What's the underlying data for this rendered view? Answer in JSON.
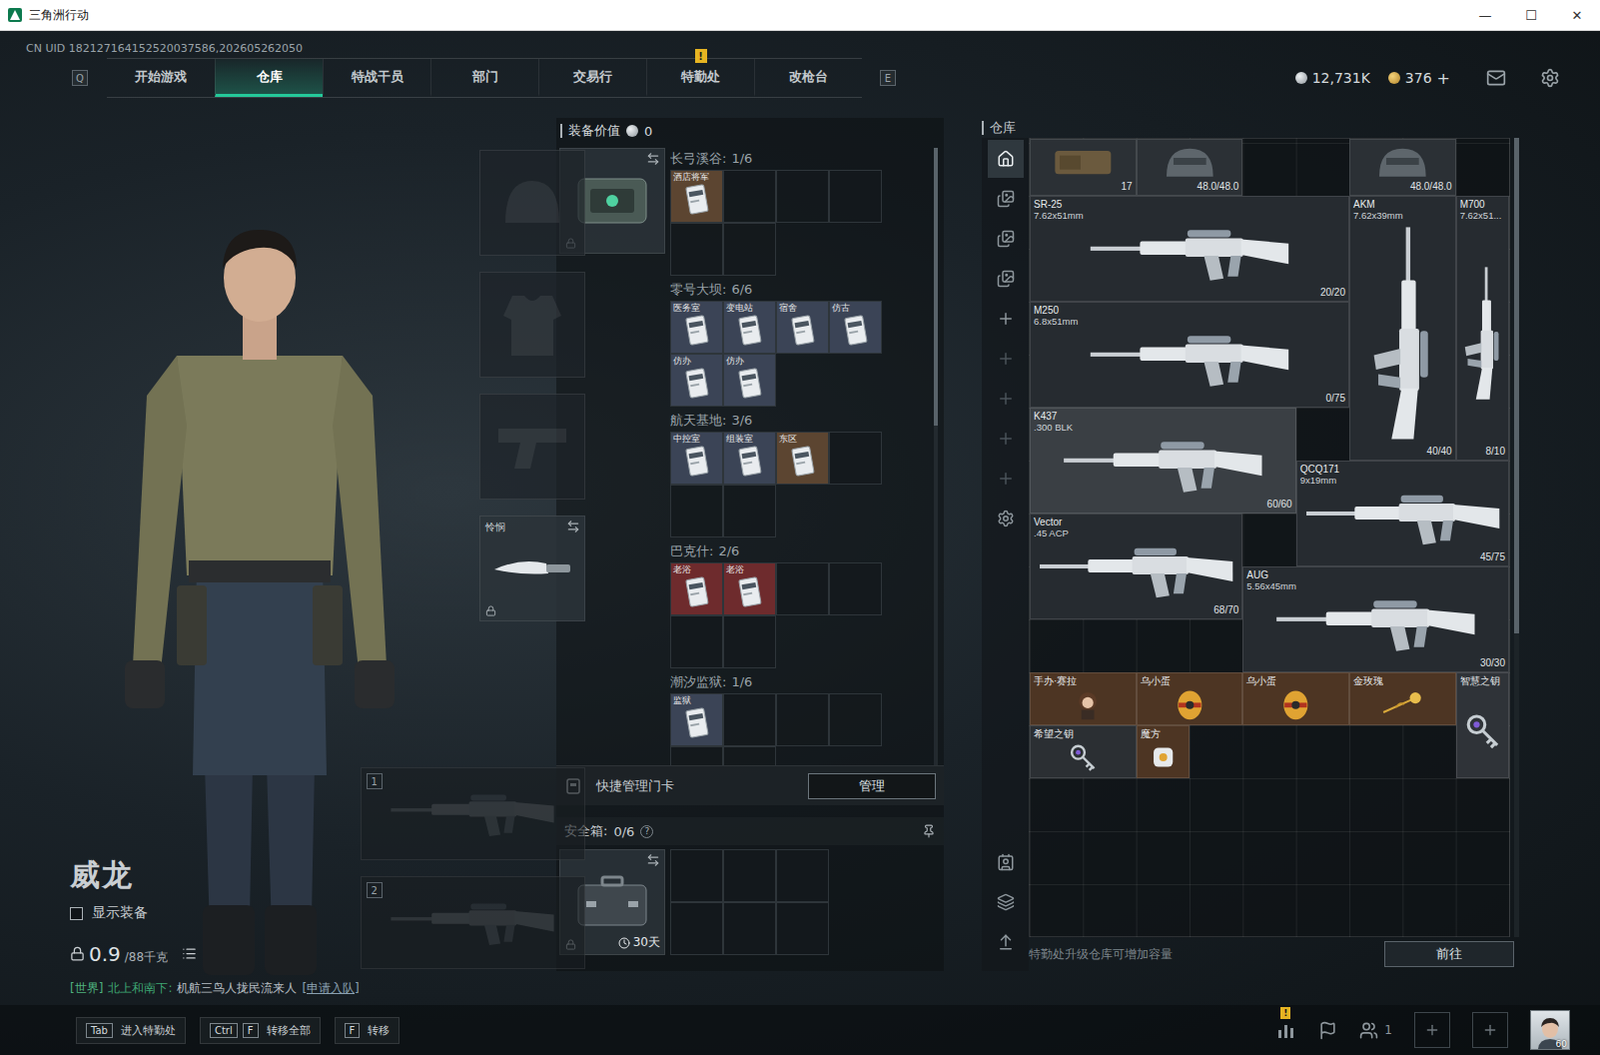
{
  "window": {
    "title": "三角洲行动",
    "controls": [
      "—",
      "☐",
      "✕"
    ]
  },
  "uid": "CN UID 182127164152520037586,202605262050",
  "nav": {
    "left_key": "Q",
    "right_key": "E",
    "tabs": [
      {
        "label": "开始游戏",
        "selected": false
      },
      {
        "label": "仓库",
        "selected": true
      },
      {
        "label": "特战干员",
        "selected": false
      },
      {
        "label": "部门",
        "selected": false
      },
      {
        "label": "交易行",
        "selected": false
      },
      {
        "label": "特勤处",
        "selected": false,
        "badge": "!"
      },
      {
        "label": "改枪台",
        "selected": false
      }
    ]
  },
  "currency": [
    {
      "kind": "silver",
      "amount": "12,731K"
    },
    {
      "kind": "gold",
      "amount": "376",
      "add": "+"
    }
  ],
  "character": {
    "name": "威龙",
    "show_equipment": {
      "label": "显示装备",
      "checked": false
    },
    "weight": "0.9",
    "capacity": "/88千克"
  },
  "equipment": [
    {
      "kind": "helmet",
      "filled": false,
      "locked": false
    },
    {
      "kind": "armor",
      "filled": false,
      "locked": false
    },
    {
      "kind": "pistol",
      "filled": false,
      "locked": false
    },
    {
      "kind": "melee",
      "label": "怜悯",
      "filled": true,
      "locked": true
    }
  ],
  "weapon_slots": [
    {
      "number": "1",
      "filled": false
    },
    {
      "number": "2",
      "filled": false
    }
  ],
  "chat": {
    "channel": "[世界]",
    "sender": "北上和南下:",
    "message": "机航三鸟人拢民流来人",
    "action": "[申请入队]"
  },
  "loadout": {
    "title": "装备价值",
    "value": "0",
    "case_locked": true,
    "scroll_thumb": 0.45,
    "keycard_groups": [
      {
        "map": "长弓溪谷:",
        "count": "1/6",
        "cards": [
          {
            "label": "酒店将军",
            "color": "#5c4531"
          }
        ]
      },
      {
        "map": "零号大坝:",
        "count": "6/6",
        "cards": [
          {
            "label": "医务室",
            "color": "#3b4456"
          },
          {
            "label": "变电站",
            "color": "#3b4456"
          },
          {
            "label": "宿舍",
            "color": "#3b4456"
          },
          {
            "label": "仿古",
            "color": "#3b4456"
          },
          {
            "label": "仿办",
            "color": "#3b4456"
          },
          {
            "label": "仿办",
            "color": "#3b4456"
          }
        ]
      },
      {
        "map": "航天基地:",
        "count": "3/6",
        "cards": [
          {
            "label": "中控室",
            "color": "#3b4456"
          },
          {
            "label": "组装室",
            "color": "#3b4456"
          },
          {
            "label": "东区",
            "color": "#5c4531"
          }
        ]
      },
      {
        "map": "巴克什:",
        "count": "2/6",
        "cards": [
          {
            "label": "老浴",
            "color": "#6e2b2d"
          },
          {
            "label": "老浴",
            "color": "#6e2b2d"
          }
        ]
      },
      {
        "map": "潮汐监狱:",
        "count": "1/6",
        "cards": [
          {
            "label": "监狱",
            "color": "#3b4456"
          }
        ]
      }
    ],
    "quick_manage": {
      "label": "快捷管理门卡",
      "button": "管理"
    },
    "safe_box": {
      "label": "安全箱:",
      "count": "0/6",
      "help": "?",
      "days": "30天",
      "locked": true
    }
  },
  "stash": {
    "title": "仓库",
    "scroll_thumb": 0.62,
    "rail_top": [
      {
        "kind": "home",
        "selected": true
      },
      {
        "kind": "gallery",
        "selected": false
      },
      {
        "kind": "gallery",
        "selected": false
      },
      {
        "kind": "gallery",
        "selected": false
      },
      {
        "kind": "add",
        "selected": false
      },
      {
        "kind": "slot",
        "selected": false
      },
      {
        "kind": "slot",
        "selected": false
      },
      {
        "kind": "slot",
        "selected": false
      },
      {
        "kind": "slot",
        "selected": false
      },
      {
        "kind": "settings",
        "selected": false
      }
    ],
    "rail_bottom": [
      {
        "kind": "profile",
        "selected": false
      },
      {
        "kind": "layers",
        "selected": false
      },
      {
        "kind": "upload",
        "selected": false
      }
    ],
    "items": [
      {
        "kind": "gear",
        "ammo": "17",
        "color": "#2b3035"
      },
      {
        "kind": "helmet",
        "ammo": "48.0/48.0",
        "color": "#2b3035"
      },
      {
        "kind": "helmet",
        "ammo": "48.0/48.0",
        "color": "#2b3035"
      },
      {
        "kind": "gun",
        "name": "SR-25",
        "sub": "7.62x51mm",
        "ammo": "20/20",
        "color": "#262b30"
      },
      {
        "kind": "gun-vertical",
        "name": "AKM",
        "sub": "7.62x39mm",
        "ammo": "40/40",
        "color": "#262b30"
      },
      {
        "kind": "gun-vertical",
        "name": "M700",
        "sub": "7.62x51...",
        "ammo": "8/10",
        "color": "#262b30"
      },
      {
        "kind": "gun",
        "name": "M250",
        "sub": "6.8x51mm",
        "ammo": "0/75",
        "color": "#262b30"
      },
      {
        "kind": "gun",
        "name": "K437",
        "sub": ".300 BLK",
        "ammo": "60/60",
        "color": "#3a3f44"
      },
      {
        "kind": "gun",
        "name": "QCQ171",
        "sub": "9x19mm",
        "ammo": "45/75",
        "color": "#262b30"
      },
      {
        "kind": "gun",
        "name": "Vector",
        "sub": ".45 ACP",
        "ammo": "68/70",
        "color": "#262b30"
      },
      {
        "kind": "gun",
        "name": "AUG",
        "sub": "5.56x45mm",
        "ammo": "30/30",
        "color": "#262b30"
      },
      {
        "kind": "figure",
        "name": "手办·赛拉",
        "color": "#4d3523"
      },
      {
        "kind": "egg",
        "name": "乌小蛋",
        "color": "#4d3523"
      },
      {
        "kind": "egg",
        "name": "乌小蛋",
        "color": "#4d3523"
      },
      {
        "kind": "rose",
        "name": "金玫瑰",
        "color": "#4d3523"
      },
      {
        "kind": "key",
        "name": "智慧之钥",
        "color": "#2f3338"
      },
      {
        "kind": "key",
        "name": "希望之钥",
        "color": "#2b2f33"
      },
      {
        "kind": "cube",
        "name": "魔方",
        "color": "#4d3523"
      }
    ],
    "footer": "特勤处升级仓库可增加容量",
    "footer_button": "前往"
  },
  "bottom_bar": {
    "hints": [
      {
        "keys": [
          "Tab"
        ],
        "label": "进入特勤处"
      },
      {
        "keys": [
          "Ctrl",
          "F"
        ],
        "label": "转移全部"
      },
      {
        "keys": [
          "F"
        ],
        "label": "转移"
      }
    ],
    "stats_badge": "!",
    "friends": "1",
    "level": "60"
  }
}
